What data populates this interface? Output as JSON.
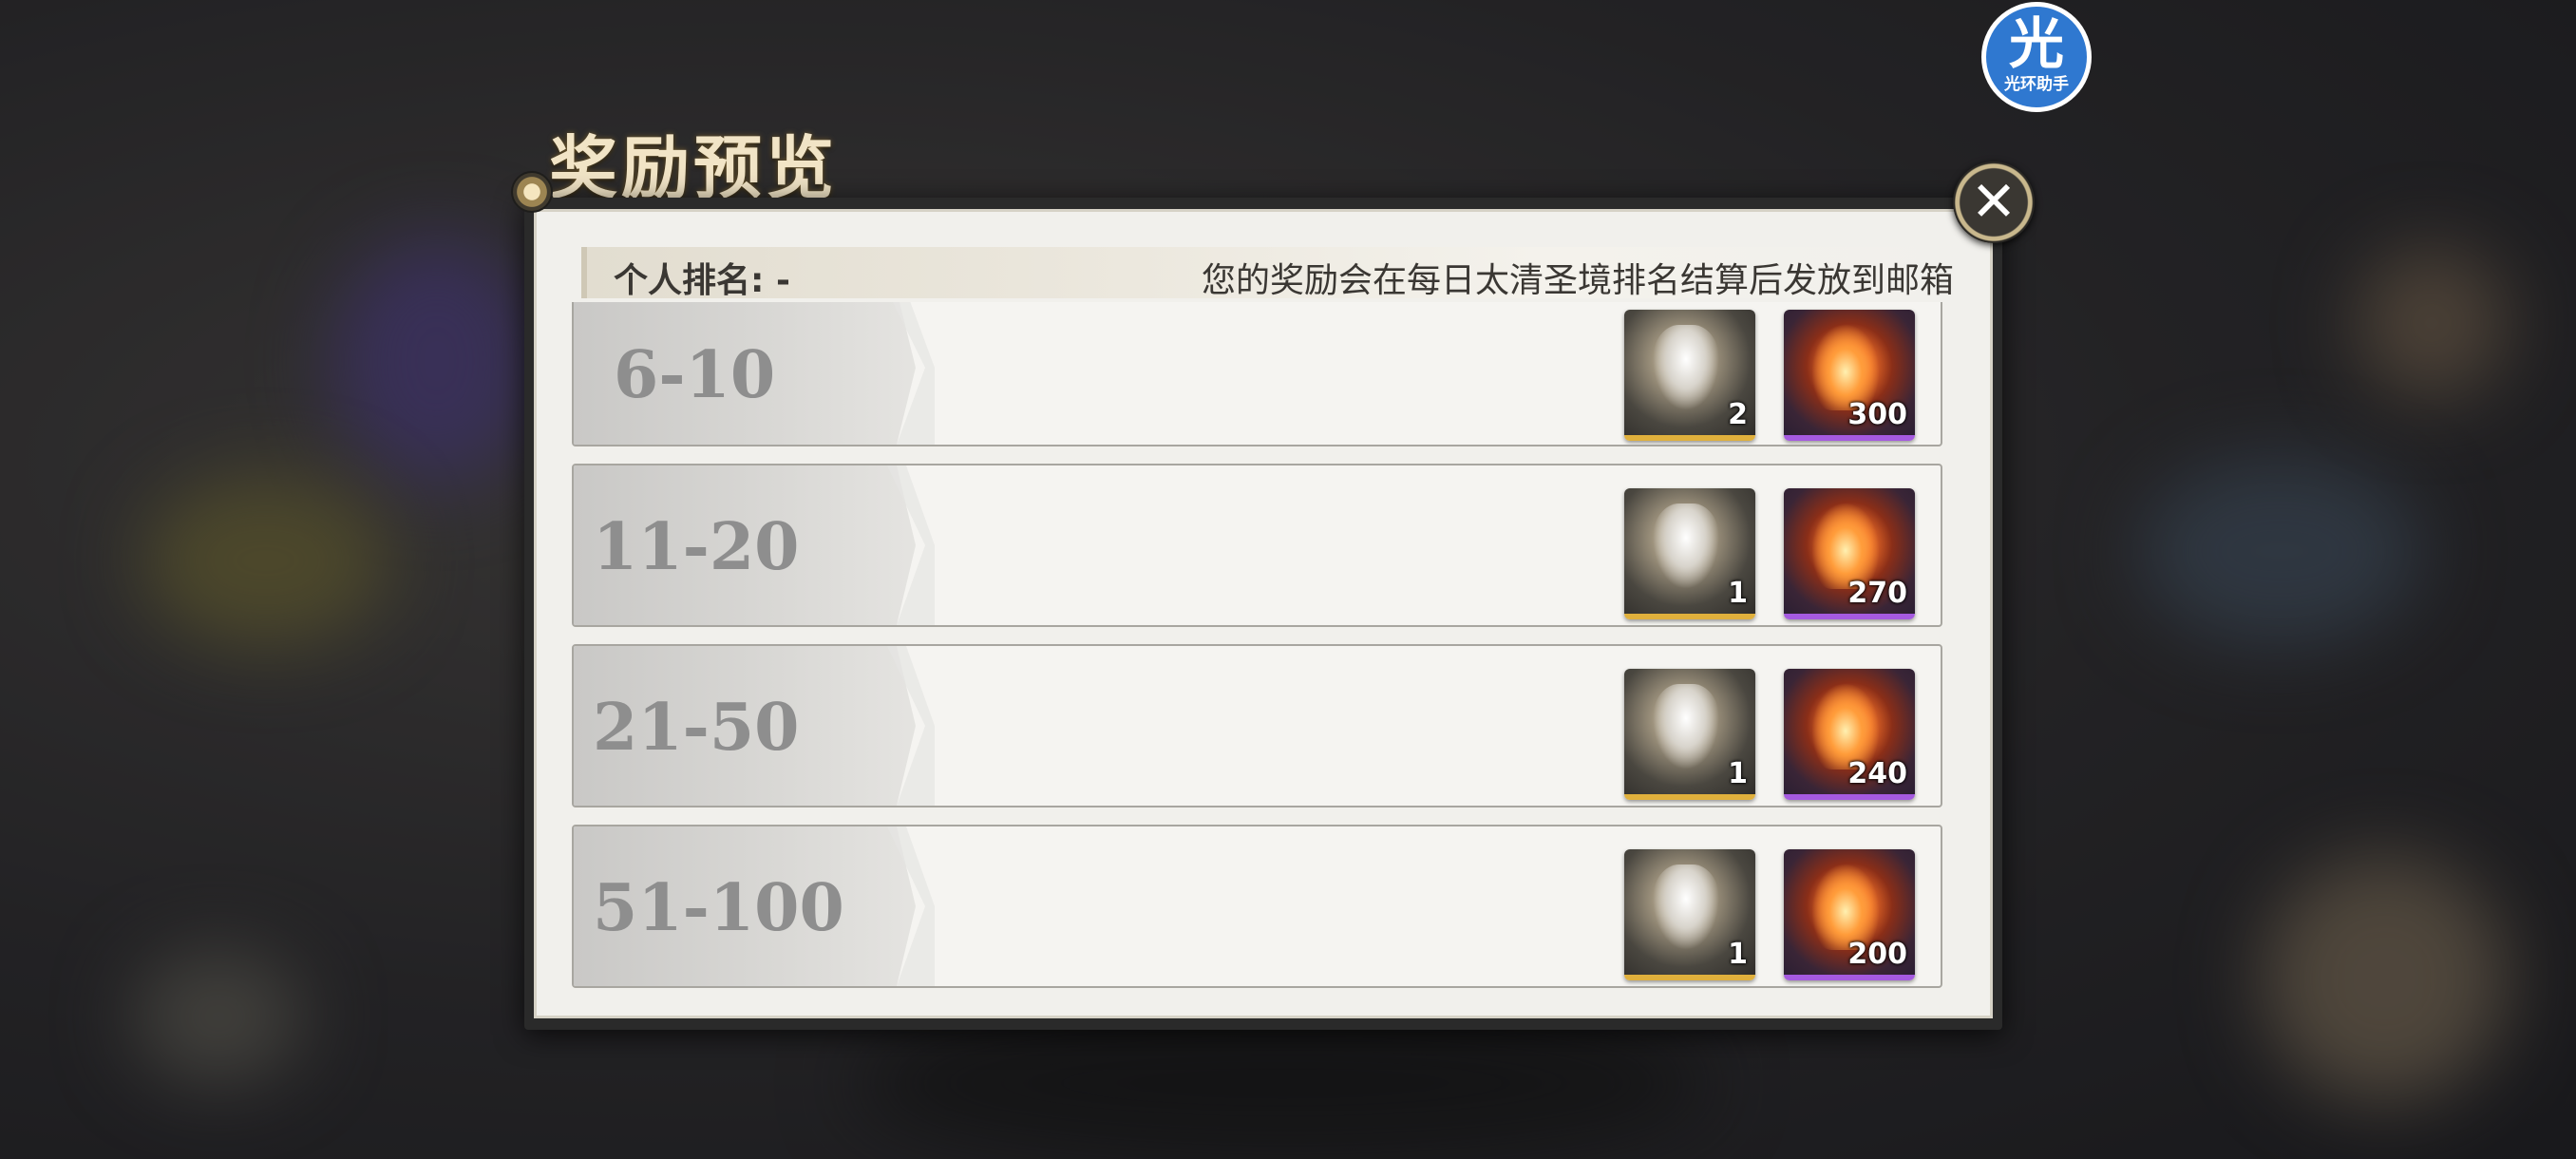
{
  "page": {
    "title": "奖励预览"
  },
  "helper_badge": {
    "big": "光",
    "small": "光环助手"
  },
  "info": {
    "rank_label": "个人排名:",
    "rank_value": "-",
    "notice": "您的奖励会在每日太清圣境排名结算后发放到邮箱"
  },
  "colors": {
    "gold_border": "#e0b03c",
    "purple_border": "#a55ae0",
    "panel_bg": "#f1f0ec"
  },
  "rows": [
    {
      "range": "6-10",
      "items": [
        {
          "icon": "character-card-icon",
          "rarity": "gold",
          "qty": "2"
        },
        {
          "icon": "flame-material-icon",
          "rarity": "purple",
          "qty": "300"
        }
      ]
    },
    {
      "range": "11-20",
      "items": [
        {
          "icon": "character-card-icon",
          "rarity": "gold",
          "qty": "1"
        },
        {
          "icon": "flame-material-icon",
          "rarity": "purple",
          "qty": "270"
        }
      ]
    },
    {
      "range": "21-50",
      "items": [
        {
          "icon": "character-card-icon",
          "rarity": "gold",
          "qty": "1"
        },
        {
          "icon": "flame-material-icon",
          "rarity": "purple",
          "qty": "240"
        }
      ]
    },
    {
      "range": "51-100",
      "items": [
        {
          "icon": "character-card-icon",
          "rarity": "gold",
          "qty": "1"
        },
        {
          "icon": "flame-material-icon",
          "rarity": "purple",
          "qty": "200"
        }
      ]
    }
  ],
  "close_icon": "close-icon"
}
